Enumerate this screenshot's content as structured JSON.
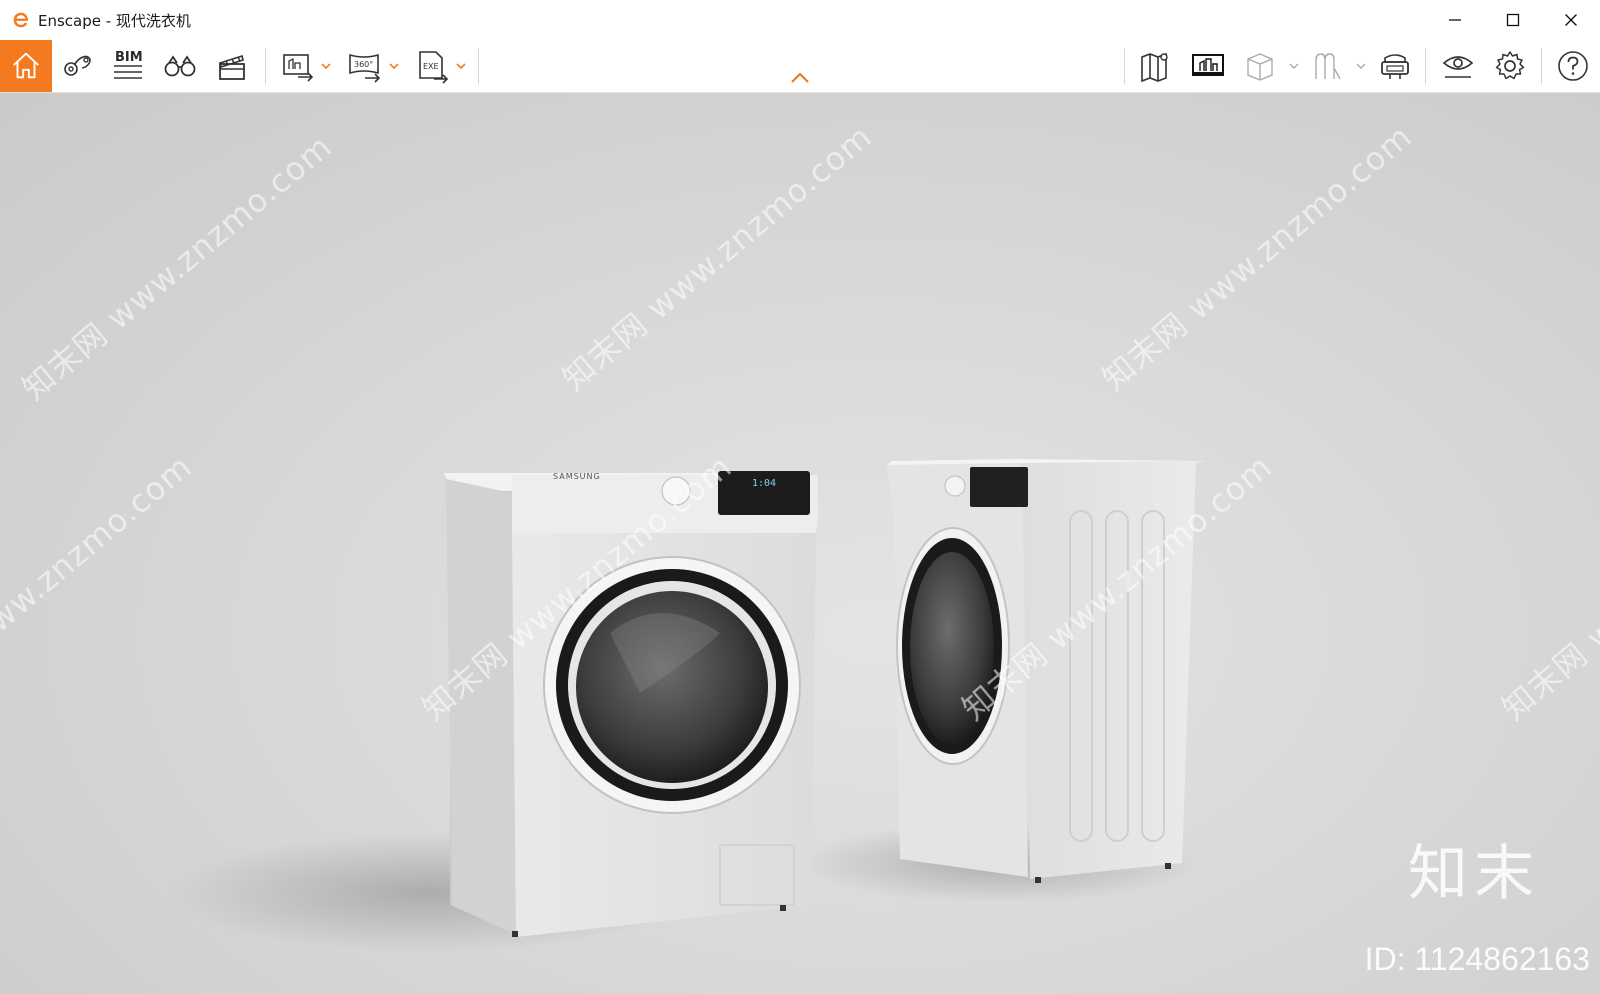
{
  "window": {
    "title": "Enscape - 现代洗衣机",
    "brand_color": "#f47a1f",
    "controls": [
      "minimize-icon",
      "maximize-icon",
      "close-icon"
    ]
  },
  "toolbar": {
    "left_buttons": [
      {
        "name": "home",
        "icon": "home-icon"
      },
      {
        "name": "views-and-locations",
        "icon": "map-pin-icon"
      },
      {
        "name": "bim",
        "icon": "bim-icon",
        "label": "BIM"
      },
      {
        "name": "walk-mode",
        "icon": "binoculars-icon"
      },
      {
        "name": "video-editor",
        "icon": "clapperboard-icon"
      },
      {
        "name": "screenshot-export",
        "icon": "image-export-icon"
      },
      {
        "name": "panorama-export",
        "icon": "panorama-export-icon",
        "label": "360°"
      },
      {
        "name": "standalone-export",
        "icon": "exe-export-icon",
        "label": "EXE"
      }
    ],
    "right_buttons": [
      {
        "name": "map-view",
        "icon": "map-icon"
      },
      {
        "name": "view-management",
        "icon": "monitor-buildings-icon"
      },
      {
        "name": "safe-frame",
        "icon": "cube-icon"
      },
      {
        "name": "atmosphere",
        "icon": "paint-icon"
      },
      {
        "name": "vr-headset",
        "icon": "vr-headset-icon"
      },
      {
        "name": "visual-settings",
        "icon": "eye-icon"
      },
      {
        "name": "settings",
        "icon": "gear-icon"
      },
      {
        "name": "help",
        "icon": "help-icon"
      }
    ],
    "collapse_icon": "chevron-up-icon"
  },
  "viewport": {
    "watermark_text": "知末网 www.znzmo.com",
    "brand_mark": "知末",
    "brand_id": "ID: 1124862163",
    "appliance_label": "SAMSUNG",
    "display_readout": "1:04"
  }
}
